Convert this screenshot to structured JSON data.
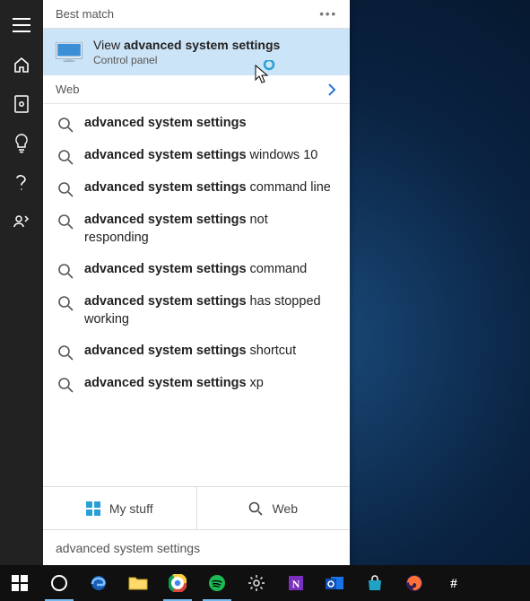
{
  "best_match_header": "Best match",
  "best_match": {
    "line1_prefix": "View ",
    "line1_bold": "advanced system settings",
    "line2": "Control panel"
  },
  "web_header": "Web",
  "results": [
    {
      "bold": "advanced system settings",
      "tail": ""
    },
    {
      "bold": "advanced system settings",
      "tail": " windows 10"
    },
    {
      "bold": "advanced system settings",
      "tail": " command line"
    },
    {
      "bold": "advanced system settings",
      "tail": " not responding"
    },
    {
      "bold": "advanced system settings",
      "tail": " command"
    },
    {
      "bold": "advanced system settings",
      "tail": " has stopped working"
    },
    {
      "bold": "advanced system settings",
      "tail": " shortcut"
    },
    {
      "bold": "advanced system settings",
      "tail": " xp"
    }
  ],
  "tabs": {
    "my_stuff": "My stuff",
    "web": "Web"
  },
  "search_value": "advanced system settings",
  "taskbar_icons": [
    "start-icon",
    "cortana-icon",
    "edge-icon",
    "file-explorer-icon",
    "chrome-icon",
    "spotify-icon",
    "settings-icon",
    "onenote-icon",
    "outlook-icon",
    "store-icon",
    "firefox-icon",
    "slack-icon"
  ]
}
